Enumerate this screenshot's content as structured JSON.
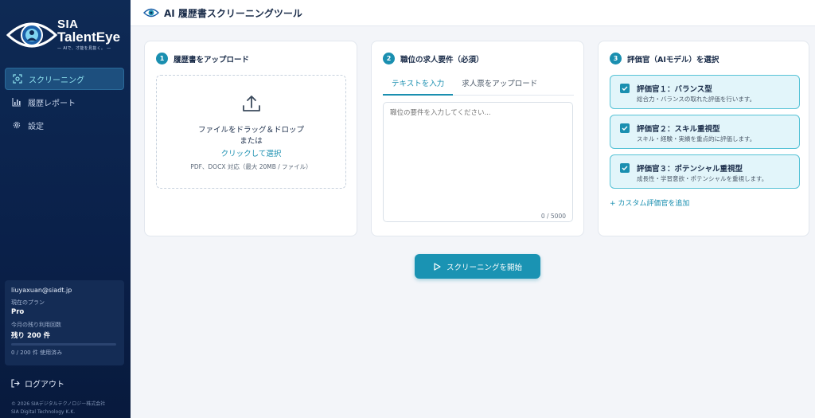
{
  "brand": {
    "line1": "SIA",
    "line2": "TalentEye",
    "tagline": "— AIで、才能を見抜く。 —"
  },
  "sidebar": {
    "items": [
      {
        "label": "スクリーニング",
        "icon": "scan-icon",
        "active": true
      },
      {
        "label": "履歴レポート",
        "icon": "bar-chart-icon",
        "active": false
      },
      {
        "label": "設定",
        "icon": "gear-icon",
        "active": false
      }
    ],
    "account": {
      "email": "liuyaxuan@siadt.jp",
      "plan_label": "現在のプラン",
      "plan_value": "Pro",
      "remaining_label": "今月の残り利用回数",
      "remaining_value": "残り 200 件",
      "usage_text": "0 / 200 件 使用済み",
      "usage_fraction": 0
    },
    "logout_label": "ログアウト",
    "copyright_line1": "© 2026 SIAデジタルテクノロジー株式会社",
    "copyright_line2": "SIA Digital Technology K.K."
  },
  "header": {
    "title": "AI 履歴書スクリーニングツール"
  },
  "upload": {
    "step": "1",
    "title": "履歴書をアップロード",
    "drop_text": "ファイルをドラッグ＆ドロップ",
    "or_text": "または",
    "click_text": "クリックして選択",
    "note": "PDF、DOCX 対応（最大 20MB / ファイル）"
  },
  "requirements": {
    "step": "2",
    "title": "職位の求人要件（必須）",
    "tabs": [
      "テキストを入力",
      "求人票をアップロード"
    ],
    "placeholder": "職位の要件を入力してください...",
    "counter": "0 / 5000"
  },
  "evaluators": {
    "step": "3",
    "title": "評価官（AIモデル）を選択",
    "items": [
      {
        "name": "評価官１：バランス型",
        "desc": "総合力・バランスの取れた評価を行います。",
        "checked": true
      },
      {
        "name": "評価官２：スキル重視型",
        "desc": "スキル・経験・実績を重点的に評価します。",
        "checked": true
      },
      {
        "name": "評価官３：ポテンシャル重視型",
        "desc": "成長性・学習意欲・ポテンシャルを重視します。",
        "checked": true
      }
    ],
    "add_custom": "+ カスタム評価官を追加"
  },
  "actions": {
    "start_label": "スクリーニングを開始"
  },
  "colors": {
    "accent": "#1a93b3",
    "sidebar_bg": "#0a2049",
    "evaluator_bg": "#e2f5fa"
  }
}
